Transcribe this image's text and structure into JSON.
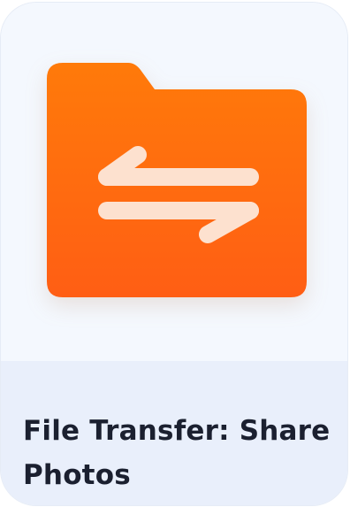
{
  "app": {
    "title": "File Transfer: Share Photos",
    "icon": "folder-transfer-icon",
    "colors": {
      "card_background": "#f4f8fe",
      "caption_background": "#e9effb",
      "folder_top": "#ff7a0a",
      "folder_bottom": "#ff5e14",
      "arrows": "#fde1cf",
      "title_text": "#1b2030"
    }
  }
}
